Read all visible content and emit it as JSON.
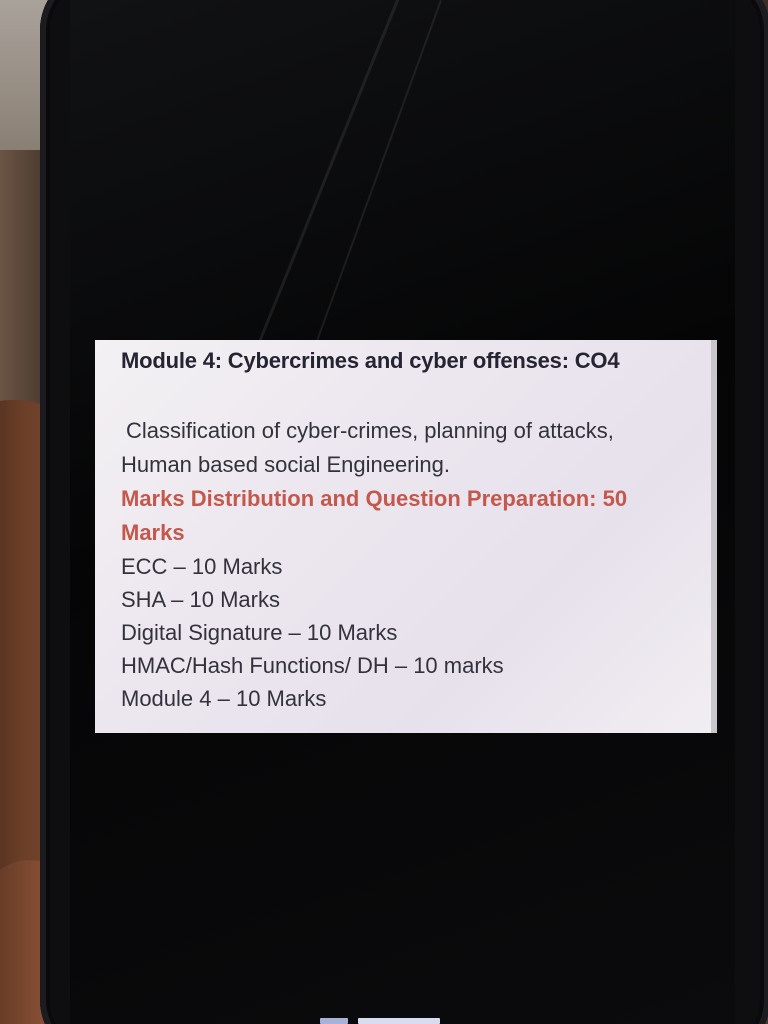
{
  "card": {
    "title": "Module 4: Cybercrimes and cyber offenses: CO4",
    "description": "Classification of cyber-crimes, planning of attacks, Human based social Engineering.",
    "highlight": "Marks Distribution and Question Preparation: 50 Marks",
    "items": [
      "ECC – 10 Marks",
      "SHA – 10 Marks",
      "Digital Signature – 10 Marks",
      "HMAC/Hash Functions/ DH – 10 marks",
      "Module 4 – 10 Marks"
    ]
  },
  "colors": {
    "highlight": "#c5584d",
    "card_background": "#efeaf0",
    "screen_background": "#080809"
  }
}
